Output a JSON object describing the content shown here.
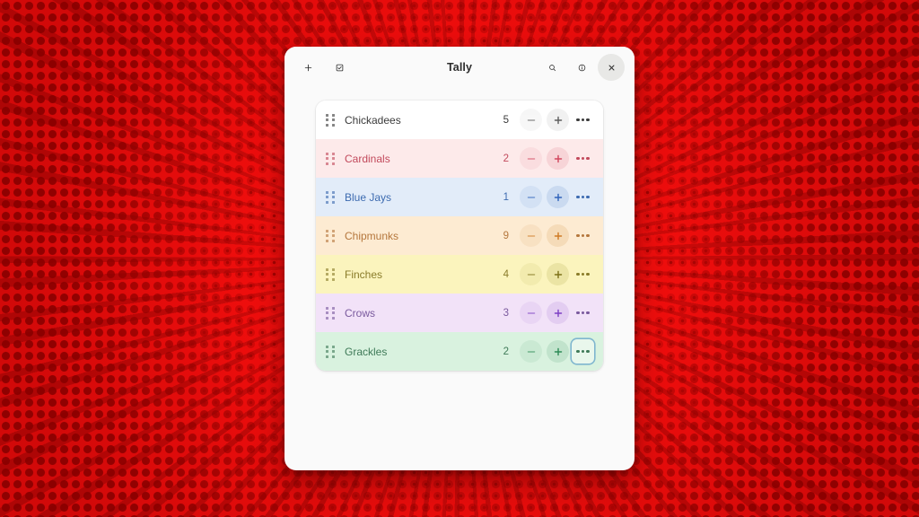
{
  "desktop": {
    "background_color": "#f40d0d",
    "style": "comic-halftone-red-burst"
  },
  "window": {
    "title": "Tally",
    "background_color": "#fafafa",
    "header": {
      "left_buttons": [
        {
          "name": "add-button",
          "icon": "plus-icon",
          "label": "+"
        },
        {
          "name": "select-mode-button",
          "icon": "checkbox-checked-icon",
          "label": ""
        }
      ],
      "right_buttons": [
        {
          "name": "search-button",
          "icon": "search-icon",
          "label": ""
        },
        {
          "name": "info-button",
          "icon": "info-circle-icon",
          "label": ""
        },
        {
          "name": "close-button",
          "icon": "close-icon",
          "label": "×"
        }
      ]
    }
  },
  "list": {
    "focused_row_index": 6,
    "focused_control": "more-menu-button",
    "rows": [
      {
        "label": "Chickadees",
        "count": "5",
        "bg": "#ffffff",
        "text": "#3b3b3b",
        "accent": "#5e5e5e",
        "btn_bg": "rgba(0,0,0,0.055)"
      },
      {
        "label": "Cardinals",
        "count": "2",
        "bg": "#fdeaea",
        "text": "#c24a5c",
        "accent": "#d2475e",
        "btn_bg": "rgba(205,70,90,0.13)"
      },
      {
        "label": "Blue Jays",
        "count": "1",
        "bg": "#e2ecf9",
        "text": "#3d6bb0",
        "accent": "#2f63ba",
        "btn_bg": "rgba(60,110,190,0.14)"
      },
      {
        "label": "Chipmunks",
        "count": "9",
        "bg": "#fdebd2",
        "text": "#b5773d",
        "accent": "#cf7a24",
        "btn_bg": "rgba(200,125,40,0.15)"
      },
      {
        "label": "Finches",
        "count": "4",
        "bg": "#fbf4bd",
        "text": "#8a7c2a",
        "accent": "#7d7118",
        "btn_bg": "rgba(150,140,30,0.15)"
      },
      {
        "label": "Crows",
        "count": "3",
        "bg": "#f2e2f8",
        "text": "#7a5a9e",
        "accent": "#7c3fc4",
        "btn_bg": "rgba(130,70,190,0.13)"
      },
      {
        "label": "Grackles",
        "count": "2",
        "bg": "#d9f2df",
        "text": "#3f7a58",
        "accent": "#2e8b57",
        "btn_bg": "rgba(50,140,90,0.14)"
      }
    ]
  },
  "focus_ring_color": "#7fb6cf"
}
